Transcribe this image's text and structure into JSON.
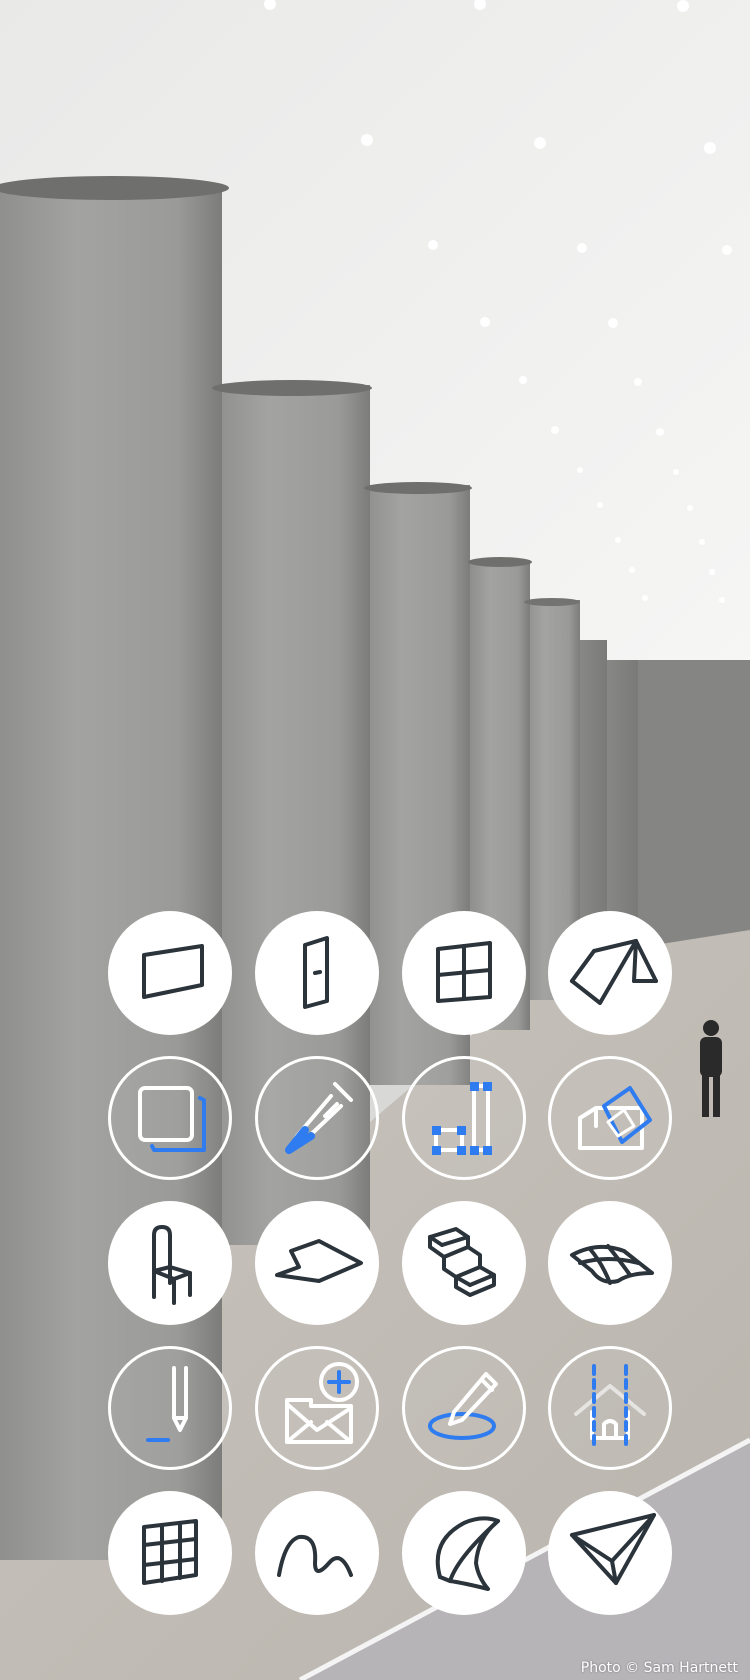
{
  "photo": {
    "credit": "Photo © Sam Hartnett"
  },
  "colors": {
    "icon_dark": "#2b333b",
    "icon_accent": "#2f7cf0",
    "circle_fill": "#ffffff"
  },
  "tools": [
    {
      "icon": "wall-icon",
      "style": "filled"
    },
    {
      "icon": "door-icon",
      "style": "filled"
    },
    {
      "icon": "window-icon",
      "style": "filled"
    },
    {
      "icon": "roof-icon",
      "style": "filled"
    },
    {
      "icon": "slab-edge-icon",
      "style": "outline"
    },
    {
      "icon": "eyedropper-icon",
      "style": "outline"
    },
    {
      "icon": "align-objects-icon",
      "style": "outline"
    },
    {
      "icon": "rotate-object-icon",
      "style": "outline"
    },
    {
      "icon": "chair-icon",
      "style": "filled"
    },
    {
      "icon": "floor-slab-icon",
      "style": "filled"
    },
    {
      "icon": "stair-icon",
      "style": "filled"
    },
    {
      "icon": "mesh-surface-icon",
      "style": "filled"
    },
    {
      "icon": "text-pen-icon",
      "style": "outline"
    },
    {
      "icon": "add-envelope-icon",
      "style": "outline"
    },
    {
      "icon": "pencil-ring-icon",
      "style": "outline"
    },
    {
      "icon": "house-section-icon",
      "style": "outline"
    },
    {
      "icon": "curtain-wall-icon",
      "style": "filled"
    },
    {
      "icon": "freeform-curve-icon",
      "style": "filled"
    },
    {
      "icon": "shell-icon",
      "style": "filled"
    },
    {
      "icon": "send-icon",
      "style": "filled"
    }
  ]
}
